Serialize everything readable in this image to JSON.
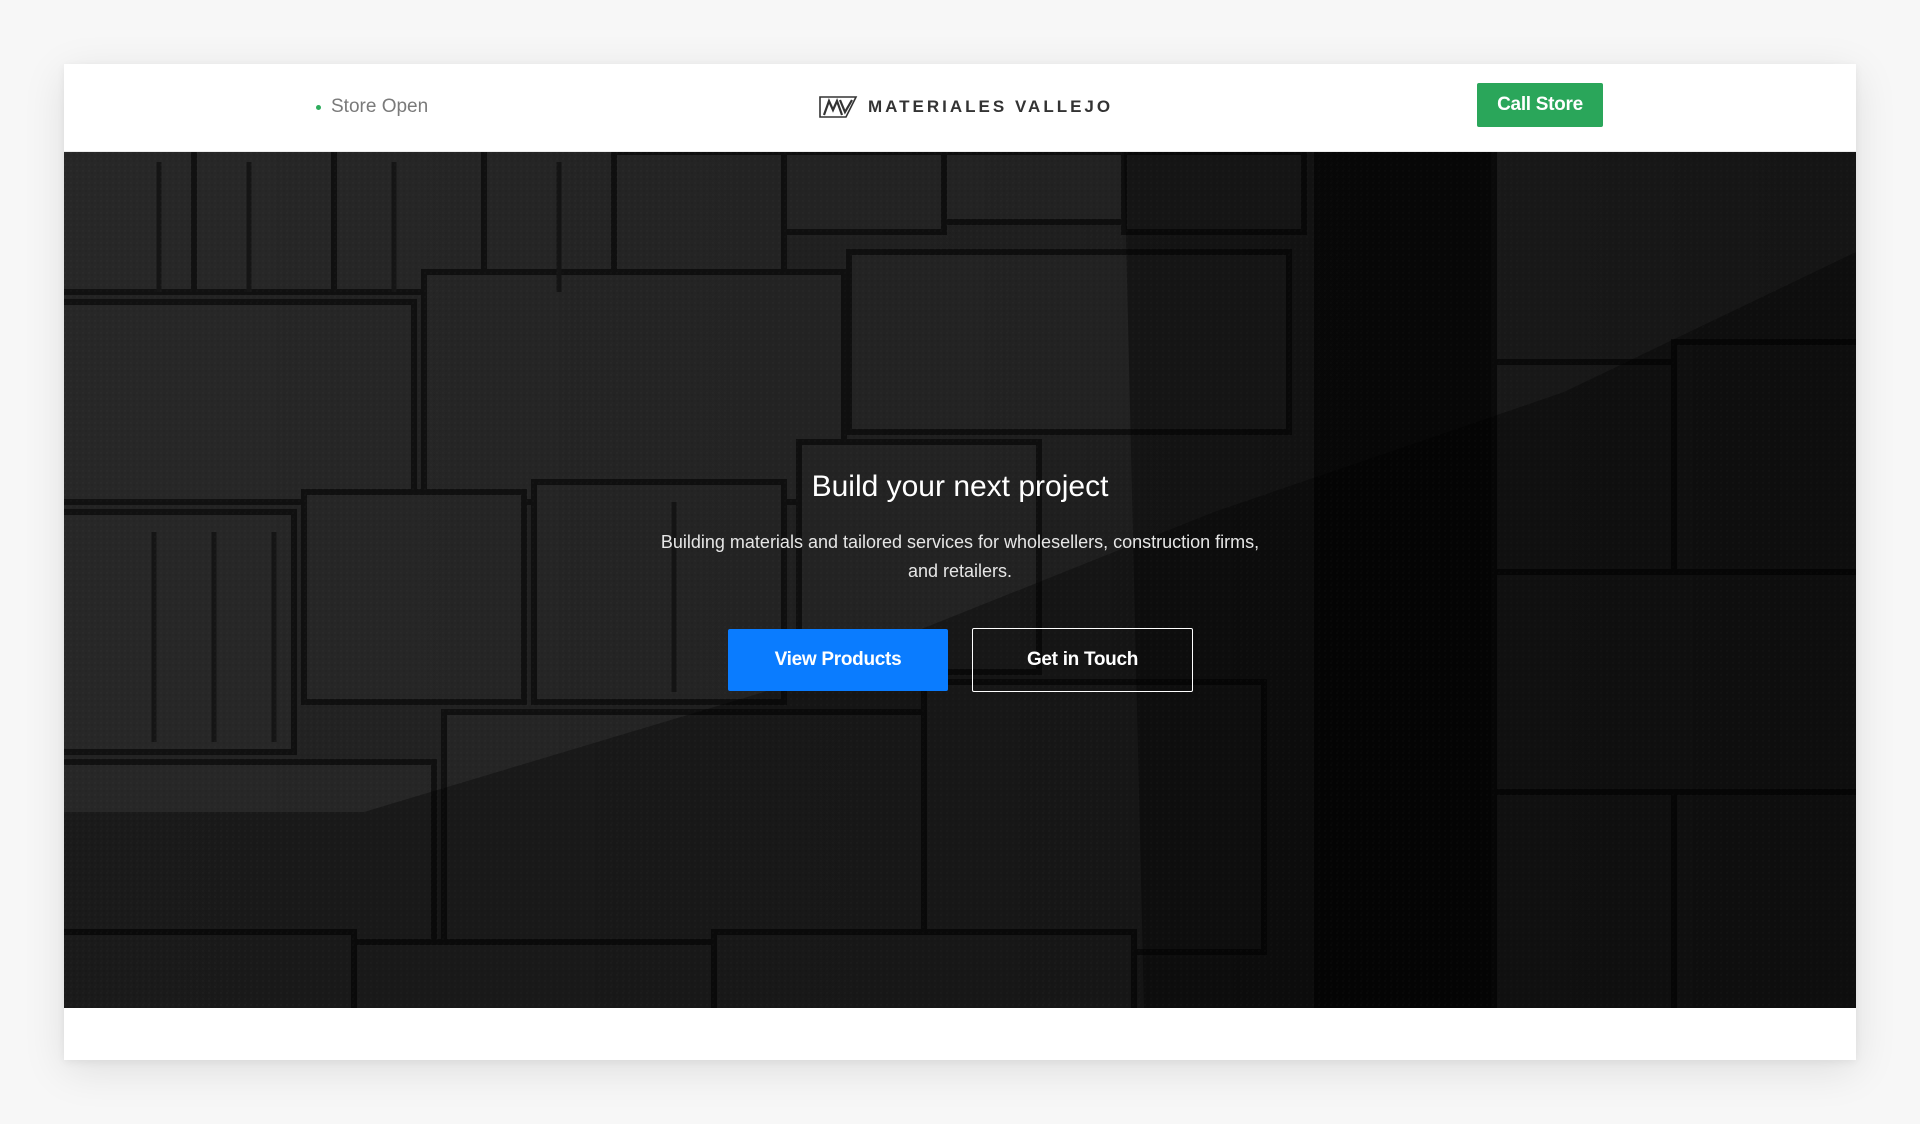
{
  "header": {
    "status_text": "Store Open",
    "brand_name": "MATERIALES VALLEJO",
    "logo_icon": "mv-monogram-logo",
    "call_label": "Call Store"
  },
  "hero": {
    "title": "Build your next project",
    "subtitle": "Building materials and tailored services for wholesellers, construction firms, and retailers.",
    "primary_label": "View Products",
    "secondary_label": "Get in Touch",
    "background": "dark photo of stacked concrete blocks"
  },
  "colors": {
    "status_dot": "#2dac5c",
    "call_button": "#2aa65a",
    "primary_button": "#0a7cff",
    "hero_overlay": "#000000"
  }
}
